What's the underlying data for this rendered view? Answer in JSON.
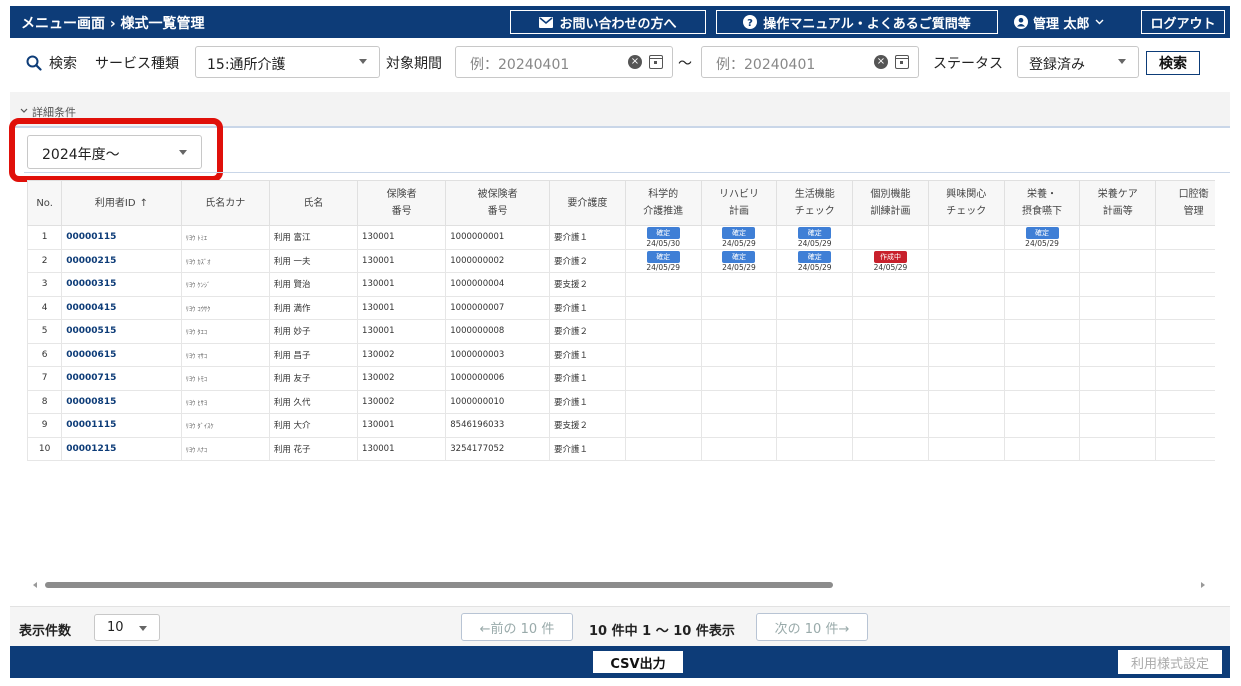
{
  "header": {
    "breadcrumb": "メニュー画面 › 様式一覧管理",
    "contact_label": "お問い合わせの方へ",
    "manual_label": "操作マニュアル・よくあるご質問等",
    "user_name": "管理 太郎",
    "logout_label": "ログアウト"
  },
  "search": {
    "search_label": "検索",
    "service_label": "サービス種類",
    "service_value": "15:通所介護",
    "period_label": "対象期間",
    "date_from_placeholder": "例：20240401",
    "tilde": "～",
    "date_to_placeholder": "例：20240401",
    "status_label": "ステータス",
    "status_value": "登録済み",
    "search_button": "検索"
  },
  "detail": {
    "toggle_label": "詳細条件"
  },
  "year_select": {
    "value": "2024年度～"
  },
  "table": {
    "headers": {
      "no": "No.",
      "id": "利用者ID",
      "kana": "氏名カナ",
      "name": "氏名",
      "insurer": "保険者\n番号",
      "insured": "被保険者\n番号",
      "care": "要介護度",
      "c1": "科学的\n介護推進",
      "c2": "リハビリ\n計画",
      "c3": "生活機能\nチェック",
      "c4": "個別機能\n訓練計画",
      "c5": "興味関心\nチェック",
      "c6": "栄養・\n摂食嚥下",
      "c7": "栄養ケア\n計画等",
      "c8": "口腔衛\n管理"
    },
    "rows": [
      {
        "no": "1",
        "id": "00000115",
        "kana": "ﾘﾖｳ ﾄﾐｴ",
        "name": "利用 富江",
        "insurer": "130001",
        "insured": "1000000001",
        "care": "要介護１",
        "c1": {
          "status": "確定",
          "date": "24/05/30"
        },
        "c2": {
          "status": "確定",
          "date": "24/05/29"
        },
        "c3": {
          "status": "確定",
          "date": "24/05/29"
        },
        "c6": {
          "status": "確定",
          "date": "24/05/29"
        }
      },
      {
        "no": "2",
        "id": "00000215",
        "kana": "ﾘﾖｳ ｶｽﾞｵ",
        "name": "利用 一夫",
        "insurer": "130001",
        "insured": "1000000002",
        "care": "要介護２",
        "c1": {
          "status": "確定",
          "date": "24/05/29"
        },
        "c2": {
          "status": "確定",
          "date": "24/05/29"
        },
        "c3": {
          "status": "確定",
          "date": "24/05/29"
        },
        "c4": {
          "status": "作成中",
          "date": "24/05/29"
        }
      },
      {
        "no": "3",
        "id": "00000315",
        "kana": "ﾘﾖｳ ｹﾝｼﾞ",
        "name": "利用 賢治",
        "insurer": "130001",
        "insured": "1000000004",
        "care": "要支援２"
      },
      {
        "no": "4",
        "id": "00000415",
        "kana": "ﾘﾖｳ ｺｳｻｸ",
        "name": "利用 満作",
        "insurer": "130001",
        "insured": "1000000007",
        "care": "要介護１"
      },
      {
        "no": "5",
        "id": "00000515",
        "kana": "ﾘﾖｳ ﾀｴｺ",
        "name": "利用 妙子",
        "insurer": "130001",
        "insured": "1000000008",
        "care": "要介護２"
      },
      {
        "no": "6",
        "id": "00000615",
        "kana": "ﾘﾖｳ ﾏｻｺ",
        "name": "利用 昌子",
        "insurer": "130002",
        "insured": "1000000003",
        "care": "要介護１"
      },
      {
        "no": "7",
        "id": "00000715",
        "kana": "ﾘﾖｳ ﾄﾓｺ",
        "name": "利用 友子",
        "insurer": "130002",
        "insured": "1000000006",
        "care": "要介護１"
      },
      {
        "no": "8",
        "id": "00000815",
        "kana": "ﾘﾖｳ ﾋｻﾖ",
        "name": "利用 久代",
        "insurer": "130002",
        "insured": "1000000010",
        "care": "要介護１"
      },
      {
        "no": "9",
        "id": "00001115",
        "kana": "ﾘﾖｳ ﾀﾞｲｽｹ",
        "name": "利用 大介",
        "insurer": "130001",
        "insured": "8546196033",
        "care": "要支援２"
      },
      {
        "no": "10",
        "id": "00001215",
        "kana": "ﾘﾖｳ ﾊﾅｺ",
        "name": "利用 花子",
        "insurer": "130001",
        "insured": "3254177052",
        "care": "要介護１"
      }
    ]
  },
  "footer": {
    "display_count_label": "表示件数",
    "display_count_value": "10",
    "prev_label": "←前の 10 件",
    "info": "10 件中 1 ～ 10 件表示",
    "next_label": "次の 10 件→"
  },
  "bottom": {
    "csv_label": "CSV出力",
    "setting_label": "利用様式設定"
  },
  "colors": {
    "navy": "#0d3c78",
    "confirmed_chip": "#3f7fd6",
    "in_progress_chip": "#c8202c",
    "highlight": "#e0100a"
  }
}
